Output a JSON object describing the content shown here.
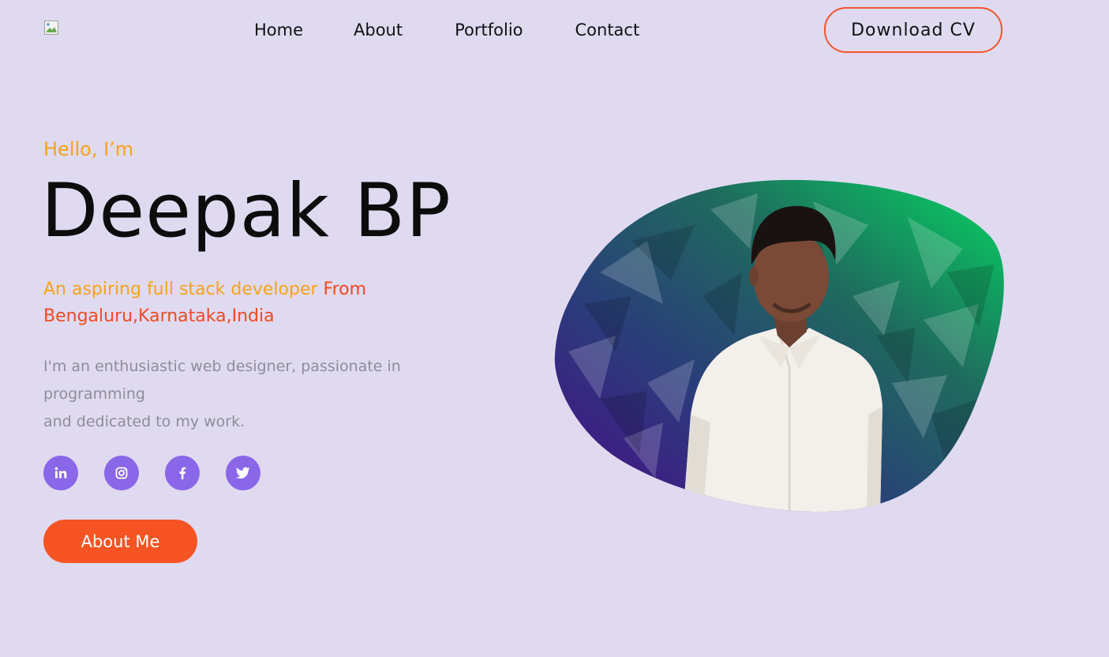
{
  "nav": {
    "items": [
      {
        "label": "Home"
      },
      {
        "label": "About"
      },
      {
        "label": "Portfolio"
      },
      {
        "label": "Contact"
      }
    ],
    "download_label": "Download CV"
  },
  "hero": {
    "greeting": "Hello, I’m",
    "name": "Deepak BP",
    "tagline_orange": "An aspiring full stack developer ",
    "tagline_red_1": "From",
    "tagline_red_2": "Bengaluru,Karnataka,India",
    "description_lines": [
      "I'm an enthusiastic web designer, passionate in",
      "programming",
      "and dedicated to my work."
    ],
    "socials": [
      {
        "icon": "linkedin-icon"
      },
      {
        "icon": "instagram-icon"
      },
      {
        "icon": "facebook-icon"
      },
      {
        "icon": "twitter-icon"
      }
    ],
    "about_button": "About Me"
  },
  "colors": {
    "background": "#e0daf1",
    "accent_orange": "#f7a21b",
    "accent_red": "#ef4a24",
    "button": "#f75424",
    "social": "#8a66e8",
    "text": "#111111",
    "muted": "#8f8c98"
  }
}
